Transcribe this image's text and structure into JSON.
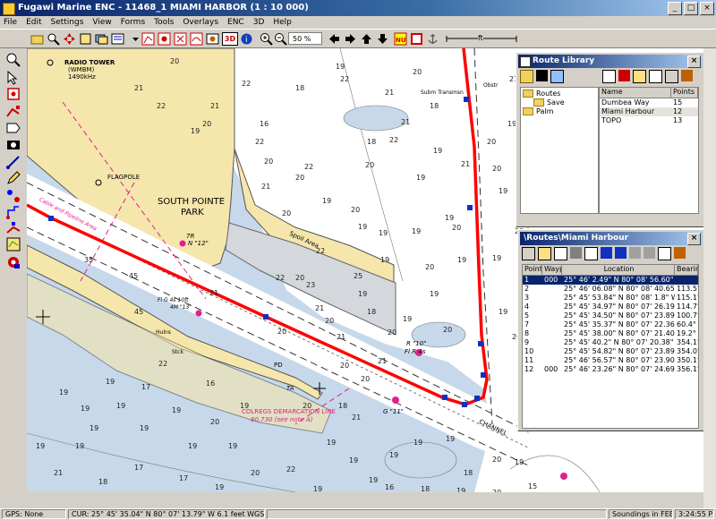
{
  "window": {
    "title": "Fugawi Marine ENC - 11468_1 MIAMI HARBOR (1 : 10 000)"
  },
  "menu": [
    "File",
    "Edit",
    "Settings",
    "View",
    "Forms",
    "Tools",
    "Overlays",
    "ENC",
    "3D",
    "Help"
  ],
  "toolbar": {
    "zoom_value": "50 %",
    "threed_label": "3D",
    "scale_label": "ft"
  },
  "chart_labels": {
    "radio_tower": "RADIO TOWER",
    "radio_call": "(WMBM)",
    "radio_freq": "1490kHz",
    "flagpole": "FLAGPOLE",
    "park_line1": "SOUTH POINTE",
    "park_line2": "PARK",
    "spoil_area": "Spoil Area",
    "cables": "Cable and Pipeline Area",
    "colregs_line1": "COLREGS DEMARCATION LINE",
    "colregs_line2": "80.730 (see note A)",
    "r10_a": "R \"10\"",
    "r10_b": "Fl R 4s",
    "fg1": "Fl G 4s 10ft",
    "fg2": "4M \"13\"",
    "fg3": "Fl G 4s",
    "r12": "N \"12\"",
    "g11": "G \"11\"",
    "fr": "7R",
    "hulns": "Hulns",
    "stack": "Stck",
    "stack2": "Stack",
    "pd": "PD",
    "ta": "TA",
    "obstr": "Obstr",
    "obstr2": "Subm Transmsn",
    "channel": "CHANNEL"
  },
  "soundings": [
    "20",
    "21",
    "22",
    "22",
    "21",
    "20",
    "19",
    "22",
    "20",
    "20",
    "20",
    "19",
    "20",
    "21",
    "21",
    "20",
    "19",
    "20",
    "19",
    "20",
    "19",
    "22",
    "20",
    "19",
    "19",
    "19",
    "19",
    "20",
    "21",
    "20",
    "19",
    "19",
    "20",
    "19",
    "19",
    "18",
    "19",
    "21",
    "20",
    "19",
    "21",
    "19",
    "20",
    "20",
    "22",
    "21",
    "35",
    "45",
    "45",
    "21",
    "20",
    "23",
    "21",
    "20",
    "20",
    "19",
    "21",
    "21",
    "20",
    "22",
    "22",
    "25",
    "20",
    "18",
    "21",
    "20",
    "19",
    "22",
    "19",
    "19",
    "17",
    "19",
    "19",
    "19",
    "19",
    "19",
    "20",
    "19",
    "22",
    "19",
    "19",
    "19",
    "19",
    "19",
    "18",
    "20",
    "19",
    "15",
    "19",
    "20",
    "18",
    "16",
    "19",
    "19",
    "20",
    "19",
    "17",
    "17",
    "18",
    "21",
    "19",
    "19",
    "19",
    "16",
    "22",
    "18",
    "18",
    "19",
    "20",
    "18",
    "16",
    "19"
  ],
  "route_library": {
    "title": "Route Library",
    "tree": [
      "Routes",
      "Save",
      "Palm"
    ],
    "columns": [
      "Name",
      "Points"
    ],
    "rows": [
      {
        "name": "Dumbea Way",
        "points": "15"
      },
      {
        "name": "Miami Harbour",
        "points": "12"
      },
      {
        "name": "TOPO",
        "points": "13"
      }
    ]
  },
  "route_panel": {
    "title": "\\Routes\\Miami Harbour",
    "columns": [
      "Point",
      "Waypoi",
      "Location",
      "Bearing"
    ],
    "rows": [
      {
        "point": "1",
        "wp": "000",
        "loc": "25° 46' 2.49\" N 80° 08' 56.60\" W",
        "bearing": ""
      },
      {
        "point": "2",
        "wp": "",
        "loc": "25° 46' 06.08\" N 80° 08' 40.65\" W",
        "bearing": "113.5°"
      },
      {
        "point": "3",
        "wp": "",
        "loc": "25° 45' 53.84\" N 80° 08' 1.8\" W",
        "bearing": "115.1°"
      },
      {
        "point": "4",
        "wp": "",
        "loc": "25° 45' 34.97\" N 80° 07' 26.19\" W",
        "bearing": "114.7°"
      },
      {
        "point": "5",
        "wp": "",
        "loc": "25° 45' 34.50\" N 80° 07' 23.89\" W",
        "bearing": "100.7°"
      },
      {
        "point": "7",
        "wp": "",
        "loc": "25° 45' 35.37\" N 80° 07' 22.36\" W",
        "bearing": "60.4°"
      },
      {
        "point": "8",
        "wp": "",
        "loc": "25° 45' 38.00\" N 80° 07' 21.40\" W",
        "bearing": "19.2°"
      },
      {
        "point": "9",
        "wp": "",
        "loc": "25° 45' 40.2\" N 80° 07' 20.38\" W",
        "bearing": "354.1°"
      },
      {
        "point": "10",
        "wp": "",
        "loc": "25° 45' 54.82\" N 80° 07' 23.89\" W",
        "bearing": "354.0°"
      },
      {
        "point": "11",
        "wp": "",
        "loc": "25° 46' 56.57\" N 80° 07' 23.90\" W",
        "bearing": "350.1°"
      },
      {
        "point": "12",
        "wp": "000",
        "loc": "25° 46' 23.26\" N 80° 07' 24.69\" W",
        "bearing": "356.1°"
      }
    ]
  },
  "status": {
    "gps": "GPS: None",
    "cursor": "CUR: 25° 45' 35.04\" N 80° 07' 13.79\" W  6.1 feet  WGS84",
    "soundings": "Soundings in FEET",
    "time": "3:24:55 PM"
  },
  "colors": {
    "route": "#ff0000",
    "land": "#f5e6ac",
    "shallow": "#c6d8ea",
    "magenta": "#e0208f"
  }
}
